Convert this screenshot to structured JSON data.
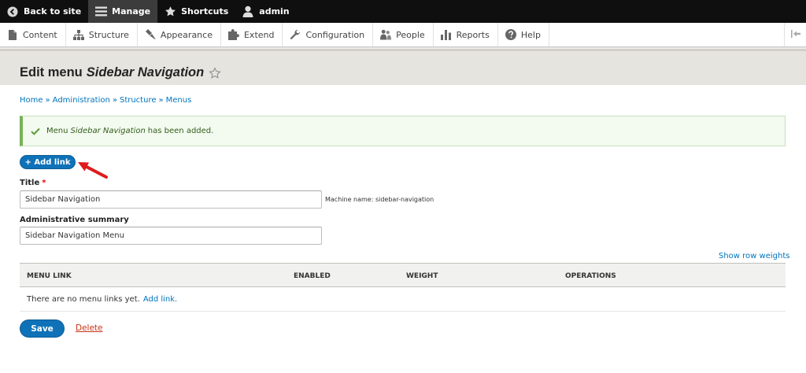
{
  "toolbar": {
    "back_to_site": "Back to site",
    "manage": "Manage",
    "shortcuts": "Shortcuts",
    "user": "admin"
  },
  "tray": {
    "items": [
      {
        "label": "Content",
        "icon": "file-icon"
      },
      {
        "label": "Structure",
        "icon": "sitemap-icon"
      },
      {
        "label": "Appearance",
        "icon": "paintbrush-icon"
      },
      {
        "label": "Extend",
        "icon": "puzzle-icon"
      },
      {
        "label": "Configuration",
        "icon": "wrench-icon"
      },
      {
        "label": "People",
        "icon": "people-icon"
      },
      {
        "label": "Reports",
        "icon": "bar-chart-icon"
      },
      {
        "label": "Help",
        "icon": "help-icon"
      }
    ]
  },
  "page": {
    "title_prefix": "Edit menu",
    "title_name": "Sidebar Navigation"
  },
  "breadcrumb": [
    "Home",
    "Administration",
    "Structure",
    "Menus"
  ],
  "breadcrumb_separator": "»",
  "status": {
    "prefix": "Menu",
    "name": "Sidebar Navigation",
    "suffix": "has been added."
  },
  "actions": {
    "add_link": "+ Add link",
    "save": "Save",
    "delete": "Delete"
  },
  "form": {
    "title_label": "Title",
    "required_mark": "*",
    "title_value": "Sidebar Navigation",
    "machine_name": "Machine name: sidebar-navigation",
    "summary_label": "Administrative summary",
    "summary_value": "Sidebar Navigation Menu"
  },
  "table": {
    "show_row_weights": "Show row weights",
    "headers": [
      "MENU LINK",
      "ENABLED",
      "WEIGHT",
      "OPERATIONS"
    ],
    "empty_text": "There are no menu links yet.",
    "empty_link": "Add link."
  },
  "colors": {
    "primary": "#0f72b8",
    "link": "#0074bd",
    "status_accent": "#77b259",
    "delete": "#c73214",
    "required": "#ee0000",
    "annotation_arrow": "#e01b1b"
  }
}
